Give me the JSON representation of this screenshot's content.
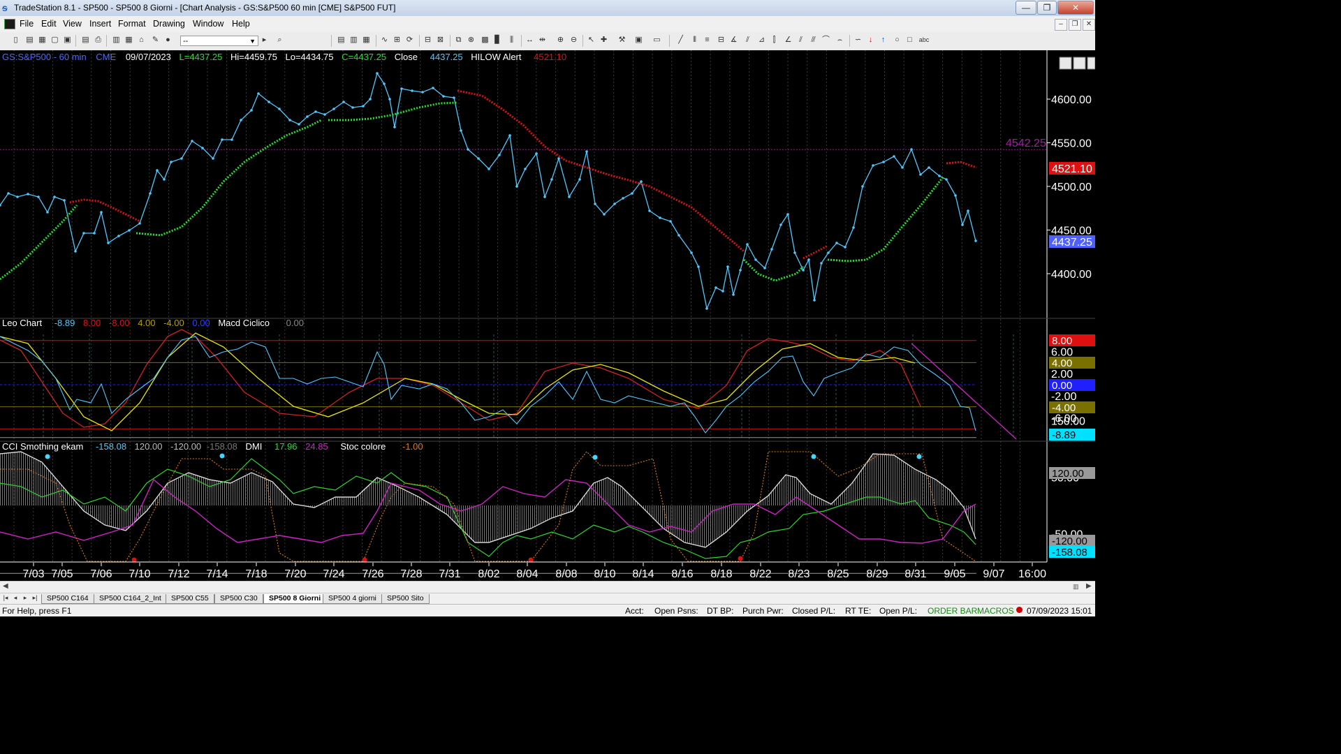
{
  "window": {
    "title": "TradeStation 8.1 - SP500 - SP500 8 Giorni - [Chart Analysis - GS:S&P500  60 min  [CME] S&P500 FUT]",
    "minimize": "—",
    "maximize": "❐",
    "close": "✕"
  },
  "menu": {
    "items": [
      "File",
      "Edit",
      "View",
      "Insert",
      "Format",
      "Drawing",
      "Window",
      "Help"
    ],
    "mdi_minimize": "–",
    "mdi_restore": "❐",
    "mdi_close": "✕"
  },
  "toolbar": {
    "combo_value": "--"
  },
  "price_header": {
    "symbol": "GS:S&P500 - 60 min",
    "exchange": "CME",
    "date": "09/07/2023",
    "last": "L=4437.25",
    "high": "Hi=4459.75",
    "low": "Lo=4434.75",
    "close_val": "C=4437.25",
    "close_label": "Close",
    "close_value": "4437.25",
    "alert_label": "HILOW Alert",
    "alert_value": "4521.10"
  },
  "macd_header": {
    "name": "Leo Chart",
    "v1": "-8.89",
    "v2": "8.00",
    "v3": "-8.00",
    "v4": "4.00",
    "v5": "-4.00",
    "v6": "0.00",
    "name2": "Macd Ciclico",
    "v7": "0.00"
  },
  "cci_header": {
    "name": "CCI Smothing ekam",
    "v1": "-158.08",
    "v2": "120.00",
    "v3": "-120.00",
    "v4": "-158.08",
    "dmi": "DMI",
    "dmi1": "17.96",
    "dmi2": "24.85",
    "stoc": "Stoc colore",
    "stoc1": "-1.00"
  },
  "price_axis": {
    "ticks": [
      "4600.00",
      "4550.00",
      "4500.00",
      "4450.00",
      "4400.00"
    ],
    "hline_label": "4542.25",
    "alert_badge": "4521.10",
    "last_badge": "4437.25"
  },
  "macd_axis": {
    "ticks": [
      "6.00",
      "2.00",
      "-2.00",
      "-6.00"
    ],
    "badge_top": "8.00",
    "badge_4": "4.00",
    "badge_0": "0.00",
    "badge_m4": "-4.00",
    "badge_last": "-8.89"
  },
  "cci_axis": {
    "ticks": [
      "150.00",
      "50.00",
      "-50.00"
    ],
    "badge_120": "120.00",
    "badge_m120": "-120.00",
    "badge_last": "-158.08"
  },
  "date_axis": [
    "7/03",
    "7/05",
    "7/06",
    "7/10",
    "7/12",
    "7/14",
    "7/18",
    "7/20",
    "7/24",
    "7/26",
    "7/28",
    "7/31",
    "8/02",
    "8/04",
    "8/08",
    "8/10",
    "8/14",
    "8/16",
    "8/18",
    "8/22",
    "8/23",
    "8/25",
    "8/29",
    "8/31",
    "9/05",
    "9/07",
    "16:00"
  ],
  "tabs": [
    "SP500 C164",
    "SP500 C164_2_Int",
    "SP500 C55",
    "SP500 C30",
    "SP500 8 Giorni",
    "SP500 4 giorni",
    "SP500 Sito"
  ],
  "active_tab": "SP500 8 Giorni",
  "status": {
    "help": "For Help, press F1",
    "acct": "Acct:",
    "open_psns": "Open Psns:",
    "dt_bp": "DT BP:",
    "purch_pwr": "Purch Pwr:",
    "closed_pl": "Closed P/L:",
    "rt_te": "RT TE:",
    "open_pl": "Open P/L:",
    "order_bar": "ORDER BAR",
    "macros": "MACROS",
    "datetime": "07/09/2023 15:01"
  },
  "colors": {
    "price": "#4fc8ff",
    "trend_up": "#22e02a",
    "trend_down": "#e01010",
    "macd_red": "#d42020",
    "macd_yellow": "#e8e800",
    "cci_white": "#cfcfcf",
    "dmi_green": "#2ad82a",
    "dmi_magenta": "#d020c8",
    "stoc_orange": "#e07a10"
  }
}
